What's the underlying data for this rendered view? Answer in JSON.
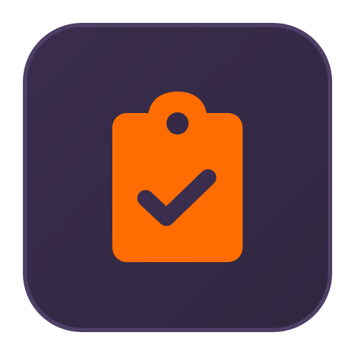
{
  "app_icon": {
    "icon": "clipboard-check-icon",
    "colors": {
      "tile_border": "#4e3f66",
      "tile_fill_top": "#3a2d4d",
      "tile_fill_bottom": "#2f2740",
      "clipboard": "#ff6d00",
      "check_and_hole": "#3a2d4d"
    }
  }
}
